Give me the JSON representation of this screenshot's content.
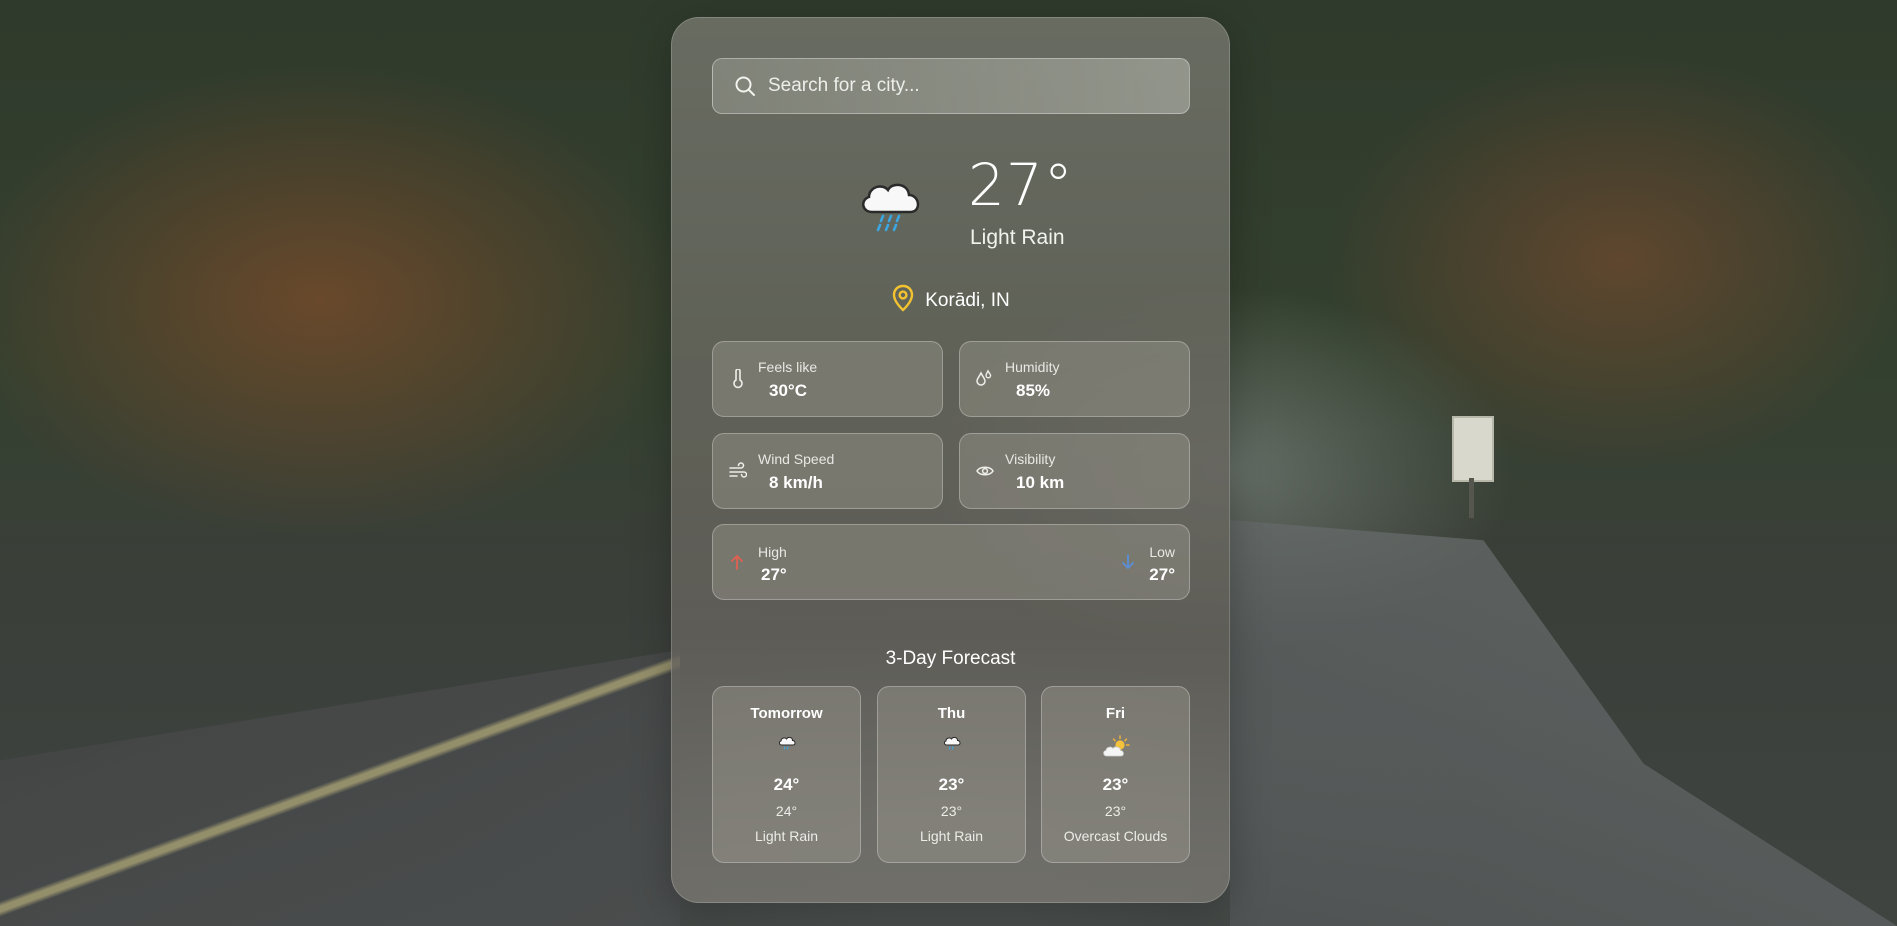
{
  "search": {
    "placeholder": "Search for a city..."
  },
  "current": {
    "temperature": "27°",
    "condition": "Light Rain",
    "location": "Korādi, IN",
    "icon": "rain-cloud-icon"
  },
  "details": {
    "feels_like": {
      "label": "Feels like",
      "value": "30°C",
      "icon": "thermometer-icon"
    },
    "humidity": {
      "label": "Humidity",
      "value": "85%",
      "icon": "droplets-icon"
    },
    "wind_speed": {
      "label": "Wind Speed",
      "value": "8 km/h",
      "icon": "wind-icon"
    },
    "visibility": {
      "label": "Visibility",
      "value": "10 km",
      "icon": "eye-icon"
    }
  },
  "high_low": {
    "high_label": "High",
    "high_value": "27°",
    "low_label": "Low",
    "low_value": "27°",
    "high_color": "#e06050",
    "low_color": "#5b8fd8"
  },
  "forecast": {
    "title": "3-Day Forecast",
    "days": [
      {
        "day": "Tomorrow",
        "high": "24°",
        "low": "24°",
        "desc": "Light Rain",
        "icon": "rain-cloud-icon"
      },
      {
        "day": "Thu",
        "high": "23°",
        "low": "23°",
        "desc": "Light Rain",
        "icon": "rain-cloud-icon"
      },
      {
        "day": "Fri",
        "high": "23°",
        "low": "23°",
        "desc": "Overcast Clouds",
        "icon": "sun-cloud-icon"
      }
    ]
  },
  "colors": {
    "location_pin": "#f2c230"
  }
}
